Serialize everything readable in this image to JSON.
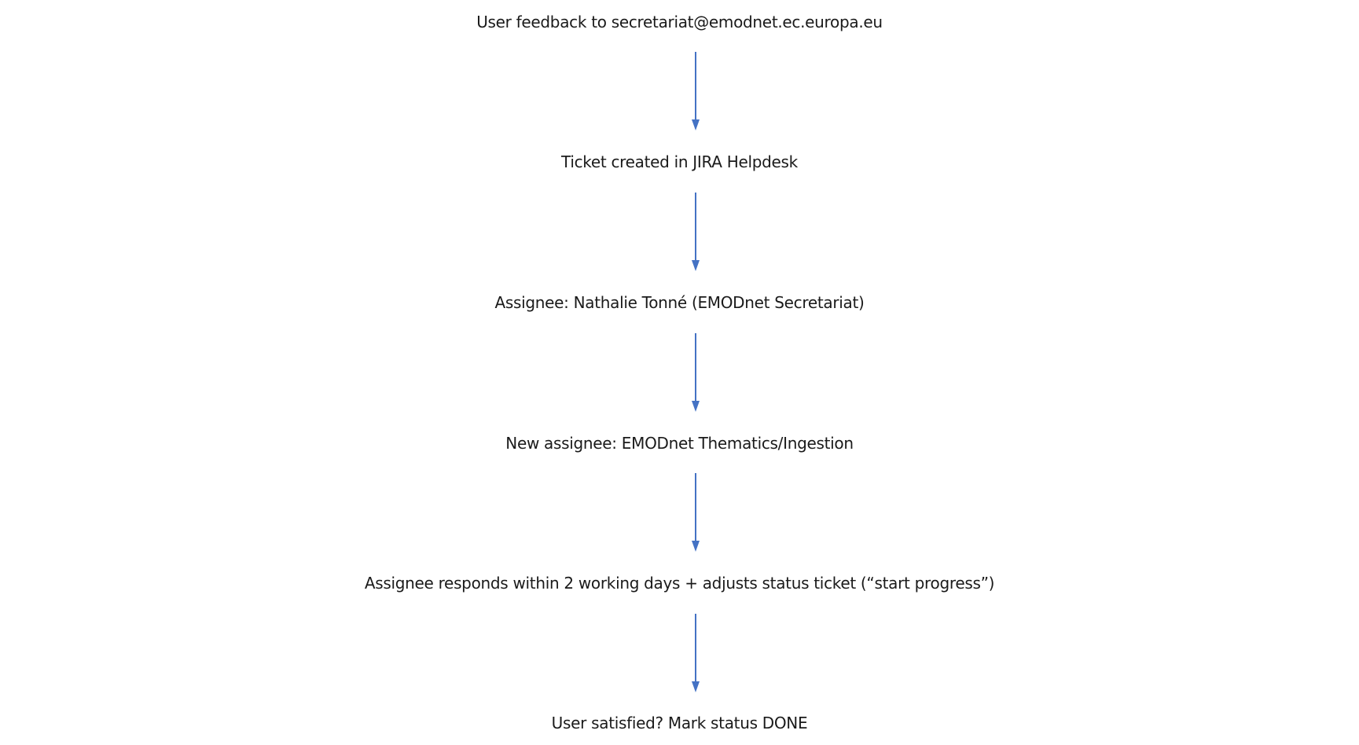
{
  "flow": {
    "steps": [
      "User feedback to secretariat@emodnet.ec.europa.eu",
      "Ticket created in JIRA Helpdesk",
      "Assignee: Nathalie Tonné (EMODnet Secretariat)",
      "New assignee: EMODnet Thematics/Ingestion",
      "Assignee responds within 2 working days + adjusts status ticket (“start progress”)",
      "User satisfied? Mark status DONE"
    ],
    "arrow_color": "#4472C4",
    "text_color": "#1a1a1a"
  }
}
